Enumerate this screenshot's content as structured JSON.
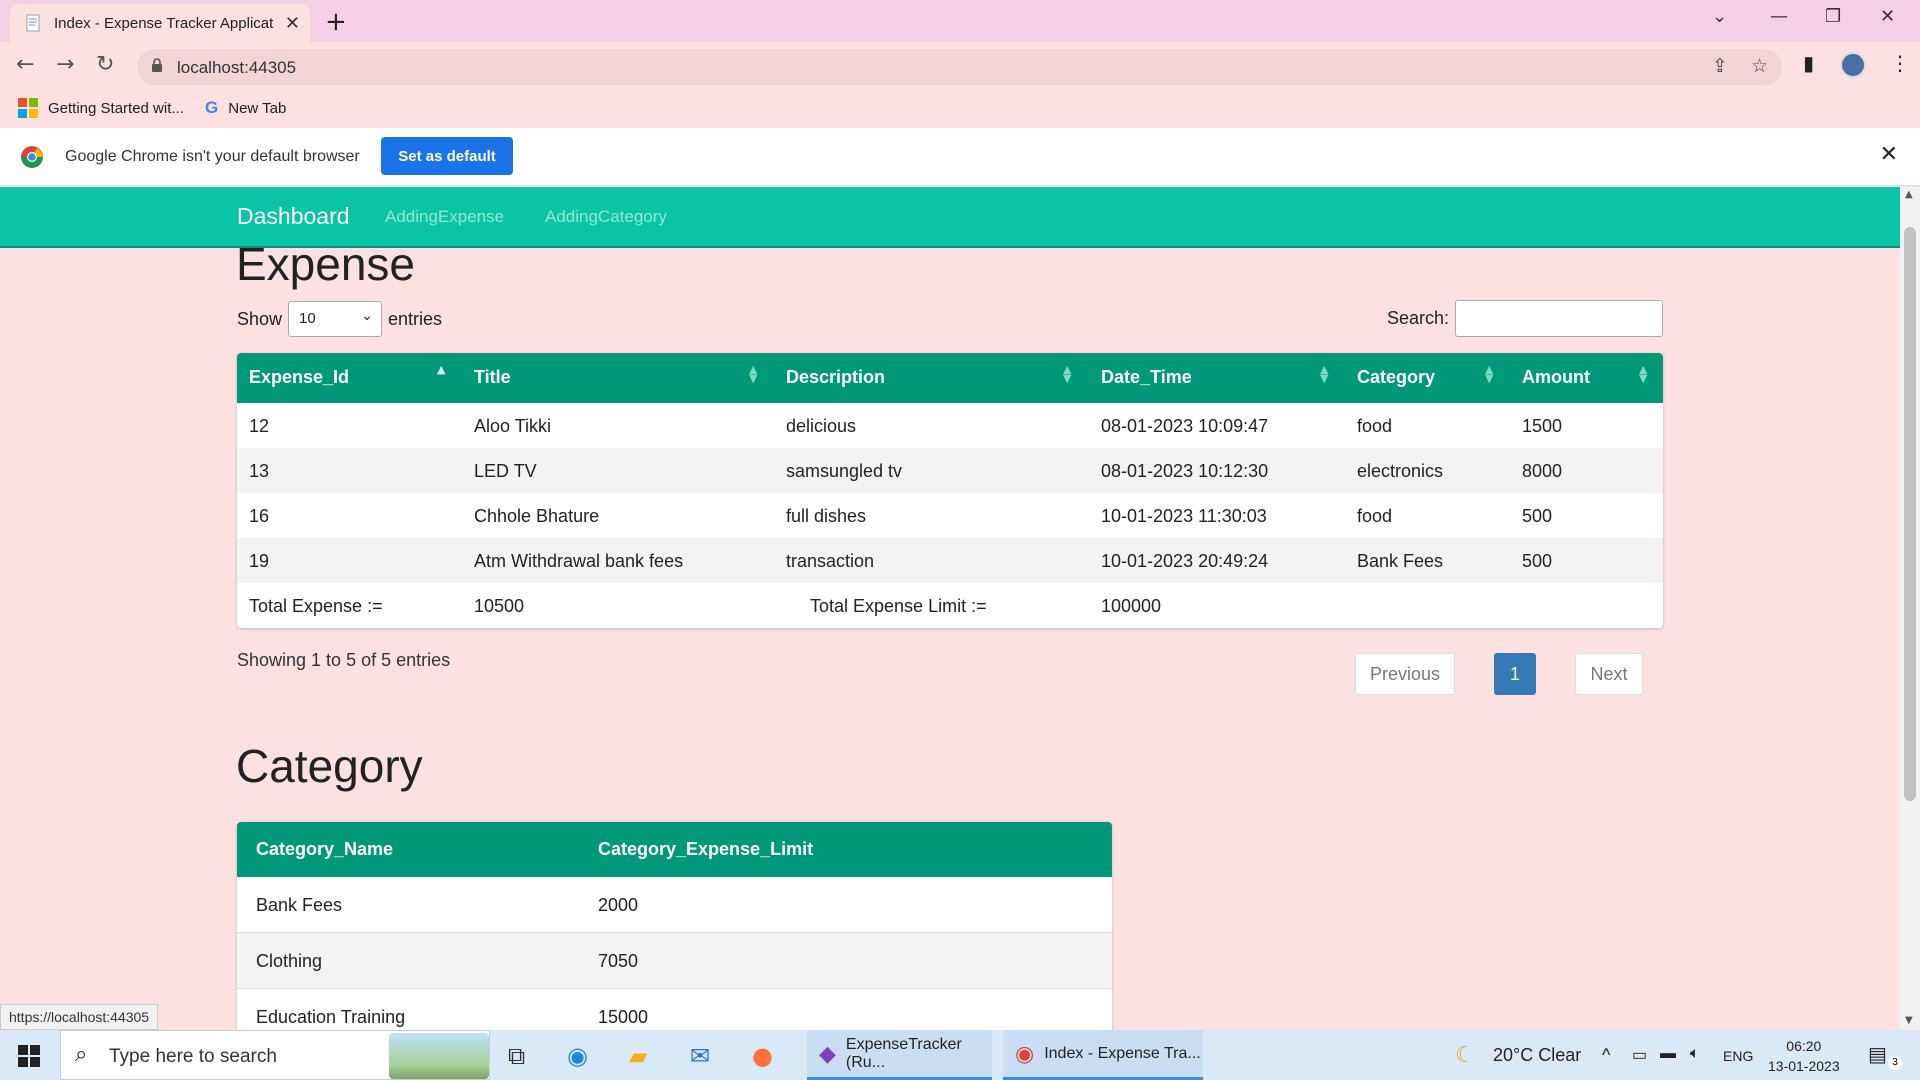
{
  "browser": {
    "tab_title": "Index - Expense Tracker Applicati",
    "url": "localhost:44305",
    "bookmarks": [
      {
        "label": "Getting Started wit..."
      },
      {
        "label": "New Tab"
      }
    ],
    "infobar_text": "Google Chrome isn't your default browser",
    "set_default_label": "Set as default",
    "status_url": "https://localhost:44305"
  },
  "navbar": {
    "brand": "Dashboard",
    "links": [
      "AddingExpense",
      "AddingCategory"
    ]
  },
  "expense": {
    "heading": "Expense",
    "show_label": "Show",
    "entries_value": "10",
    "entries_label": "entries",
    "search_label": "Search:",
    "columns": [
      "Expense_Id",
      "Title",
      "Description",
      "Date_Time",
      "Category",
      "Amount"
    ],
    "rows": [
      {
        "id": "12",
        "title": "Aloo Tikki",
        "description": "delicious",
        "date": "08-01-2023 10:09:47",
        "category": "food",
        "amount": "1500"
      },
      {
        "id": "13",
        "title": "LED TV",
        "description": "samsungled tv",
        "date": "08-01-2023 10:12:30",
        "category": "electronics",
        "amount": "8000"
      },
      {
        "id": "16",
        "title": "Chhole Bhature",
        "description": "full dishes",
        "date": "10-01-2023 11:30:03",
        "category": "food",
        "amount": "500"
      },
      {
        "id": "19",
        "title": "Atm Withdrawal bank fees",
        "description": "transaction",
        "date": "10-01-2023 20:49:24",
        "category": "Bank Fees",
        "amount": "500"
      }
    ],
    "total_label": "Total Expense :=",
    "total_value": "10500",
    "limit_label": "Total Expense Limit :=",
    "limit_value": "100000",
    "info": "Showing 1 to 5 of 5 entries",
    "prev_label": "Previous",
    "page": "1",
    "next_label": "Next"
  },
  "category": {
    "heading": "Category",
    "columns": [
      "Category_Name",
      "Category_Expense_Limit"
    ],
    "rows": [
      {
        "name": "Bank Fees",
        "limit": "2000"
      },
      {
        "name": "Clothing",
        "limit": "7050"
      },
      {
        "name": "Education Training",
        "limit": "15000"
      }
    ]
  },
  "taskbar": {
    "search_placeholder": "Type here to search",
    "apps": [
      {
        "label": "ExpenseTracker (Ru..."
      },
      {
        "label": "Index - Expense Tra..."
      }
    ],
    "weather": "20°C  Clear",
    "lang": "ENG",
    "time": "06:20",
    "date": "13-01-2023",
    "notif_count": "3"
  },
  "colors": {
    "navbar": "#0bc4a6",
    "table_header": "#009879",
    "page_bg": "#fde0e0",
    "active_page": "#337ab7"
  }
}
